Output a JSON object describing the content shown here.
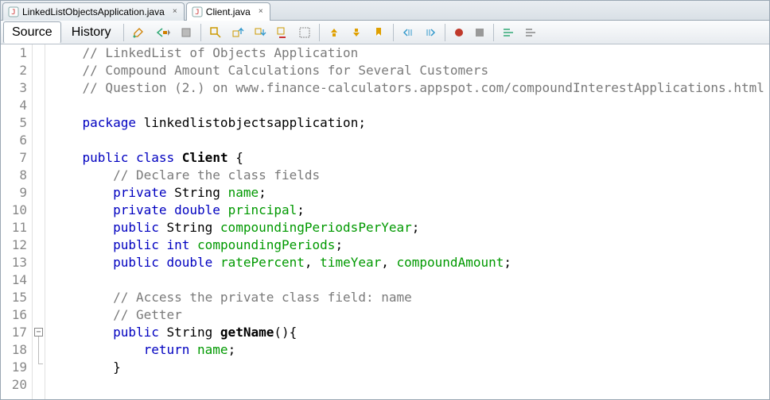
{
  "tabs": [
    {
      "label": "LinkedListObjectsApplication.java",
      "active": false
    },
    {
      "label": "Client.java",
      "active": true
    }
  ],
  "toolbar": {
    "source_label": "Source",
    "history_label": "History"
  },
  "code": {
    "line_numbers": [
      "1",
      "2",
      "3",
      "4",
      "5",
      "6",
      "7",
      "8",
      "9",
      "10",
      "11",
      "12",
      "13",
      "14",
      "15",
      "16",
      "17",
      "18",
      "19",
      "20"
    ],
    "fold_marker_line": 17,
    "lines": [
      {
        "indent": 1,
        "tokens": [
          {
            "cls": "c-comment",
            "text": "// LinkedList of Objects Application"
          }
        ]
      },
      {
        "indent": 1,
        "tokens": [
          {
            "cls": "c-comment",
            "text": "// Compound Amount Calculations for Several Customers"
          }
        ]
      },
      {
        "indent": 1,
        "tokens": [
          {
            "cls": "c-comment",
            "text": "// Question (2.) on www.finance-calculators.appspot.com/compoundInterestApplications.html"
          }
        ]
      },
      {
        "indent": 0,
        "tokens": []
      },
      {
        "indent": 1,
        "tokens": [
          {
            "cls": "c-keyword",
            "text": "package"
          },
          {
            "cls": "c-plain",
            "text": " linkedlistobjectsapplication;"
          }
        ]
      },
      {
        "indent": 0,
        "tokens": []
      },
      {
        "indent": 1,
        "tokens": [
          {
            "cls": "c-keyword",
            "text": "public"
          },
          {
            "cls": "c-plain",
            "text": " "
          },
          {
            "cls": "c-keyword",
            "text": "class"
          },
          {
            "cls": "c-plain",
            "text": " "
          },
          {
            "cls": "c-classnm",
            "text": "Client"
          },
          {
            "cls": "c-plain",
            "text": " {"
          }
        ]
      },
      {
        "indent": 2,
        "tokens": [
          {
            "cls": "c-comment",
            "text": "// Declare the class fields"
          }
        ]
      },
      {
        "indent": 2,
        "tokens": [
          {
            "cls": "c-keyword",
            "text": "private"
          },
          {
            "cls": "c-plain",
            "text": " String "
          },
          {
            "cls": "c-field",
            "text": "name"
          },
          {
            "cls": "c-plain",
            "text": ";"
          }
        ]
      },
      {
        "indent": 2,
        "tokens": [
          {
            "cls": "c-keyword",
            "text": "private"
          },
          {
            "cls": "c-plain",
            "text": " "
          },
          {
            "cls": "c-keyword",
            "text": "double"
          },
          {
            "cls": "c-plain",
            "text": " "
          },
          {
            "cls": "c-field",
            "text": "principal"
          },
          {
            "cls": "c-plain",
            "text": ";"
          }
        ]
      },
      {
        "indent": 2,
        "tokens": [
          {
            "cls": "c-keyword",
            "text": "public"
          },
          {
            "cls": "c-plain",
            "text": " String "
          },
          {
            "cls": "c-field",
            "text": "compoundingPeriodsPerYear"
          },
          {
            "cls": "c-plain",
            "text": ";"
          }
        ]
      },
      {
        "indent": 2,
        "tokens": [
          {
            "cls": "c-keyword",
            "text": "public"
          },
          {
            "cls": "c-plain",
            "text": " "
          },
          {
            "cls": "c-keyword",
            "text": "int"
          },
          {
            "cls": "c-plain",
            "text": " "
          },
          {
            "cls": "c-field",
            "text": "compoundingPeriods"
          },
          {
            "cls": "c-plain",
            "text": ";"
          }
        ]
      },
      {
        "indent": 2,
        "tokens": [
          {
            "cls": "c-keyword",
            "text": "public"
          },
          {
            "cls": "c-plain",
            "text": " "
          },
          {
            "cls": "c-keyword",
            "text": "double"
          },
          {
            "cls": "c-plain",
            "text": " "
          },
          {
            "cls": "c-field",
            "text": "ratePercent"
          },
          {
            "cls": "c-plain",
            "text": ", "
          },
          {
            "cls": "c-field",
            "text": "timeYear"
          },
          {
            "cls": "c-plain",
            "text": ", "
          },
          {
            "cls": "c-field",
            "text": "compoundAmount"
          },
          {
            "cls": "c-plain",
            "text": ";"
          }
        ]
      },
      {
        "indent": 0,
        "tokens": []
      },
      {
        "indent": 2,
        "tokens": [
          {
            "cls": "c-comment",
            "text": "// Access the private class field: name"
          }
        ]
      },
      {
        "indent": 2,
        "tokens": [
          {
            "cls": "c-comment",
            "text": "// Getter"
          }
        ]
      },
      {
        "indent": 2,
        "tokens": [
          {
            "cls": "c-keyword",
            "text": "public"
          },
          {
            "cls": "c-plain",
            "text": " String "
          },
          {
            "cls": "c-method",
            "text": "getName"
          },
          {
            "cls": "c-plain",
            "text": "(){"
          }
        ]
      },
      {
        "indent": 3,
        "tokens": [
          {
            "cls": "c-keyword",
            "text": "return"
          },
          {
            "cls": "c-plain",
            "text": " "
          },
          {
            "cls": "c-field",
            "text": "name"
          },
          {
            "cls": "c-plain",
            "text": ";"
          }
        ]
      },
      {
        "indent": 2,
        "tokens": [
          {
            "cls": "c-plain",
            "text": "}"
          }
        ]
      },
      {
        "indent": 0,
        "tokens": []
      }
    ]
  }
}
